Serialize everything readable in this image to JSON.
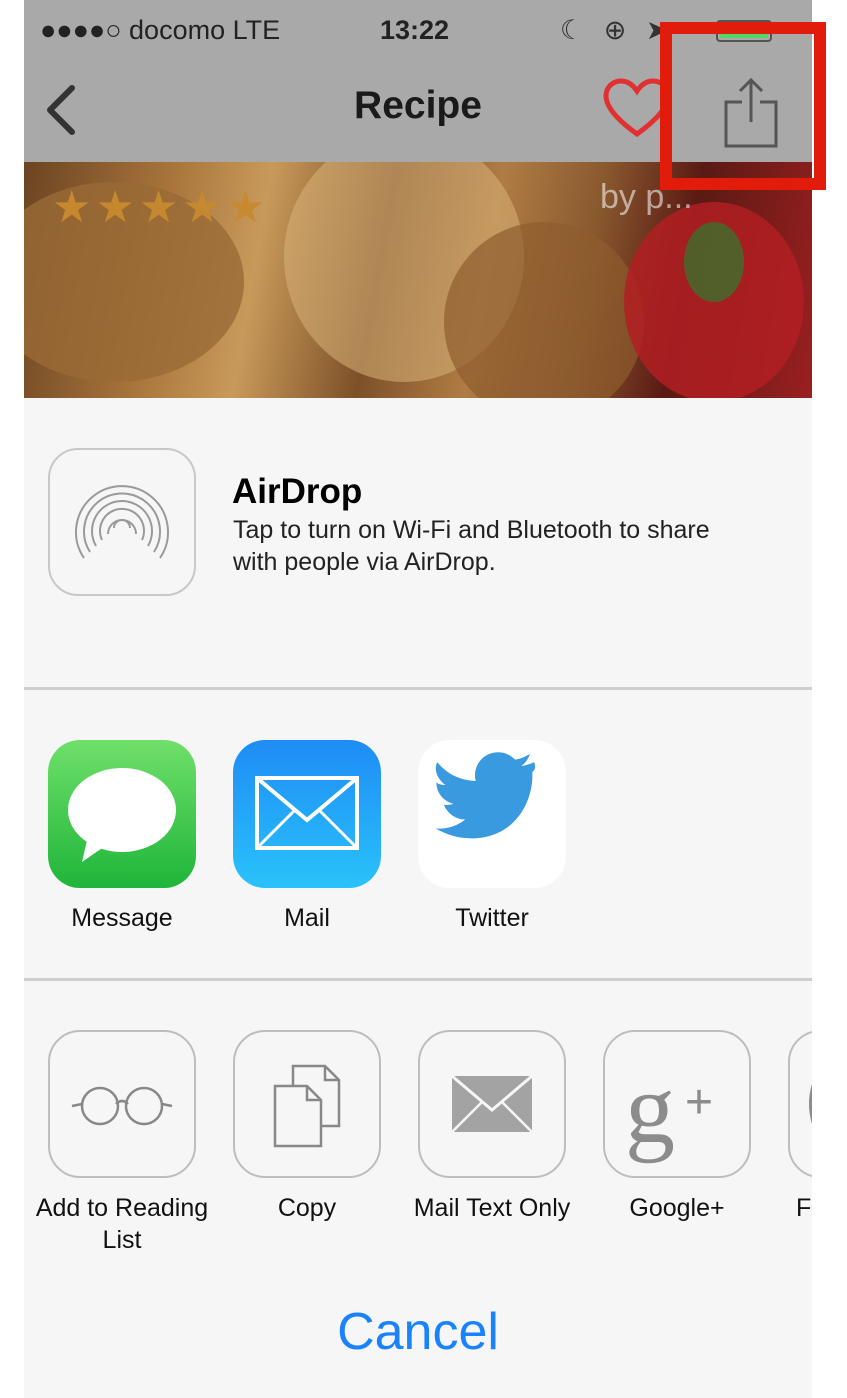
{
  "status_bar": {
    "carrier": "●●●●○ docomo  LTE",
    "time": "13:22"
  },
  "nav": {
    "title": "Recipe",
    "back_icon": "chevron-left-icon",
    "favorite_icon": "heart-icon",
    "share_icon": "share-icon"
  },
  "hero": {
    "rating_stars": "★★★★★",
    "byline": "by p..."
  },
  "airdrop": {
    "title": "AirDrop",
    "description": "Tap to turn on Wi-Fi and Bluetooth to share with people via AirDrop."
  },
  "share_apps": [
    {
      "label": "Message",
      "icon": "message-icon"
    },
    {
      "label": "Mail",
      "icon": "mail-icon"
    },
    {
      "label": "Twitter",
      "icon": "twitter-icon"
    }
  ],
  "actions": [
    {
      "label": "Add to Reading List",
      "icon": "glasses-icon"
    },
    {
      "label": "Copy",
      "icon": "copy-icon"
    },
    {
      "label": "Mail Text Only",
      "icon": "envelope-icon"
    },
    {
      "label": "Google+",
      "icon": "google-plus-icon"
    },
    {
      "label": "F",
      "icon": "partial-icon"
    }
  ],
  "cancel_label": "Cancel",
  "colors": {
    "accent_blue": "#1a82fb",
    "highlight_red": "#e11c0a",
    "heart_red": "#e03030"
  }
}
